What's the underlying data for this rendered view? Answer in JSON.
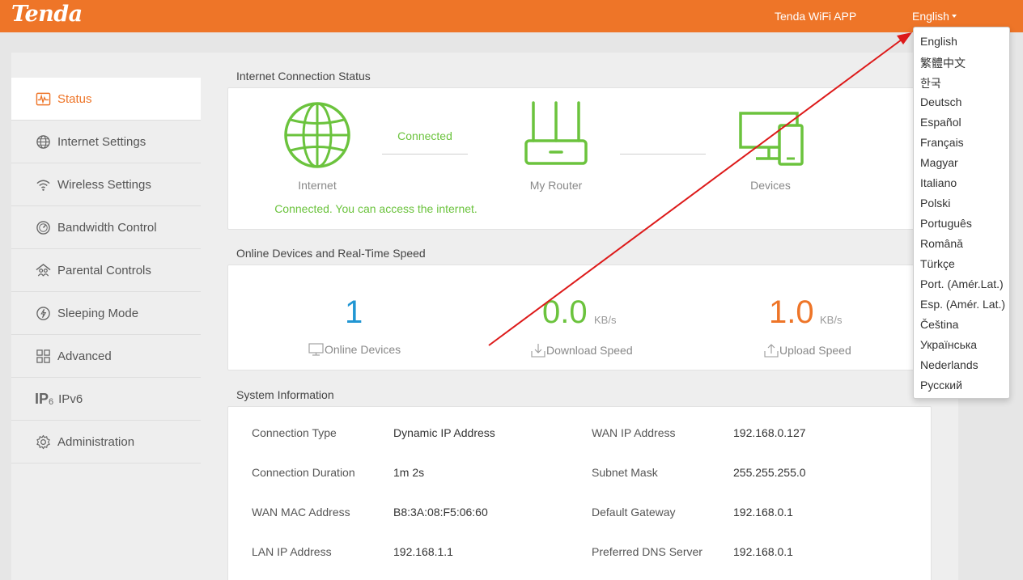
{
  "header": {
    "logo": "Tenda",
    "app_link": "Tenda WiFi APP",
    "language": "English",
    "bg_color": "#ee7528"
  },
  "sidebar": {
    "items": [
      {
        "label": "Status",
        "icon": "status-wave-icon",
        "active": true
      },
      {
        "label": "Internet Settings",
        "icon": "globe-icon"
      },
      {
        "label": "Wireless Settings",
        "icon": "wifi-icon"
      },
      {
        "label": "Bandwidth Control",
        "icon": "gauge-icon"
      },
      {
        "label": "Parental Controls",
        "icon": "family-icon"
      },
      {
        "label": "Sleeping Mode",
        "icon": "power-icon"
      },
      {
        "label": "Advanced",
        "icon": "grid-icon"
      },
      {
        "label": "IPv6",
        "icon": "ipv6-icon"
      },
      {
        "label": "Administration",
        "icon": "gear-icon"
      }
    ]
  },
  "connection": {
    "title": "Internet Connection Status",
    "internet_label": "Internet",
    "status_text": "Connected",
    "router_label": "My Router",
    "devices_label": "Devices",
    "message": "Connected. You can access the internet."
  },
  "devices": {
    "title": "Online Devices and Real-Time Speed",
    "online_count": "1",
    "online_label": "Online Devices",
    "download_value": "0.0",
    "download_unit": "KB/s",
    "download_label": "Download Speed",
    "upload_value": "1.0",
    "upload_unit": "KB/s",
    "upload_label": "Upload Speed"
  },
  "system": {
    "title": "System Information",
    "rows": [
      {
        "l1": "Connection Type",
        "v1": "Dynamic IP Address",
        "l2": "WAN IP Address",
        "v2": "192.168.0.127"
      },
      {
        "l1": "Connection Duration",
        "v1": "1m 2s",
        "l2": "Subnet Mask",
        "v2": "255.255.255.0"
      },
      {
        "l1": "WAN MAC Address",
        "v1": "B8:3A:08:F5:06:60",
        "l2": "Default Gateway",
        "v2": "192.168.0.1"
      },
      {
        "l1": "LAN IP Address",
        "v1": "192.168.1.1",
        "l2": "Preferred DNS Server",
        "v2": "192.168.0.1"
      }
    ]
  },
  "language_menu": {
    "options": [
      "English",
      "繁體中文",
      "한국",
      "Deutsch",
      "Español",
      "Français",
      "Magyar",
      "Italiano",
      "Polski",
      "Português",
      "Română",
      "Türkçe",
      "Port. (Amér.Lat.)",
      "Esp. (Amér. Lat.)",
      "Čeština",
      "Українська",
      "Nederlands",
      "Русский"
    ]
  },
  "colors": {
    "accent": "#ee7528",
    "green": "#6bc33d",
    "blue": "#2196d3",
    "arrow": "#dd1a1a"
  }
}
